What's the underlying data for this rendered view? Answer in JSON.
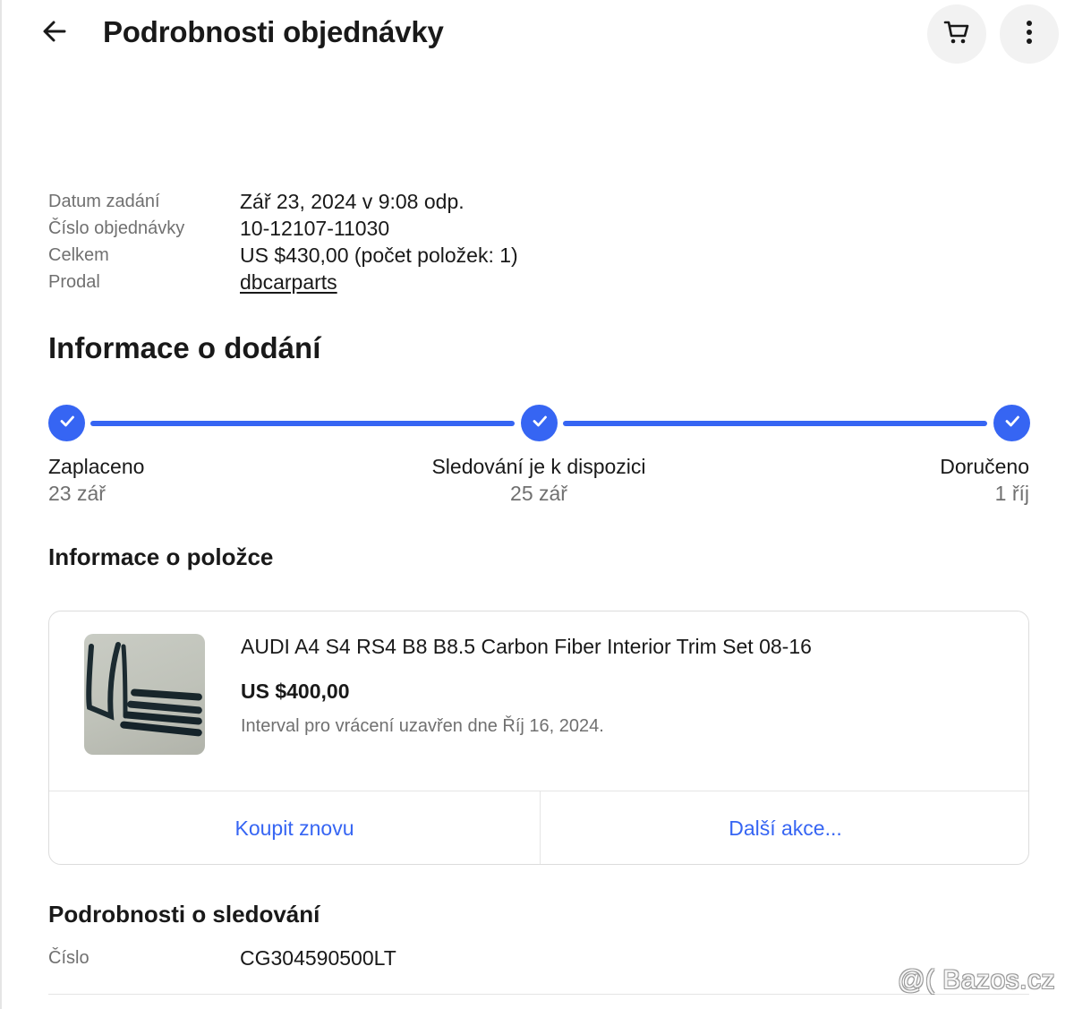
{
  "header": {
    "title": "Podrobnosti objednávky",
    "back_icon": "arrow-left-icon",
    "cart_icon": "cart-icon",
    "more_icon": "more-vertical-icon"
  },
  "summary": {
    "rows": [
      {
        "label": "Datum zadání",
        "value": "Zář 23, 2024 v 9:08 odp."
      },
      {
        "label": "Číslo objednávky",
        "value": "10-12107-11030"
      },
      {
        "label": "Celkem",
        "value": "US $430,00 (počet položek: 1)"
      },
      {
        "label": "Prodal",
        "value": "dbcarparts"
      }
    ]
  },
  "delivery": {
    "heading": "Informace o dodání",
    "steps": [
      {
        "label": "Zaplaceno",
        "date": "23 zář"
      },
      {
        "label": "Sledování je k dispozici",
        "date": "25 zář"
      },
      {
        "label": "Doručeno",
        "date": "1 říj"
      }
    ],
    "progress": 1.0
  },
  "item": {
    "heading": "Informace o položce",
    "title": "AUDI A4 S4 RS4 B8 B8.5 Carbon Fiber Interior Trim Set 08-16",
    "price": "US $400,00",
    "return_note": "Interval pro vrácení uzavřen dne Říj 16, 2024.",
    "actions": {
      "buy_again": "Koupit znovu",
      "more_actions": "Další akce..."
    }
  },
  "tracking": {
    "heading": "Podrobnosti o sledování",
    "label": "Číslo",
    "value": "CG304590500LT"
  },
  "watermark": "@( Bazos.cz",
  "colors": {
    "accent": "#3665f3",
    "text": "#191919",
    "muted": "#707070",
    "button_bg": "#f2f2f2"
  }
}
